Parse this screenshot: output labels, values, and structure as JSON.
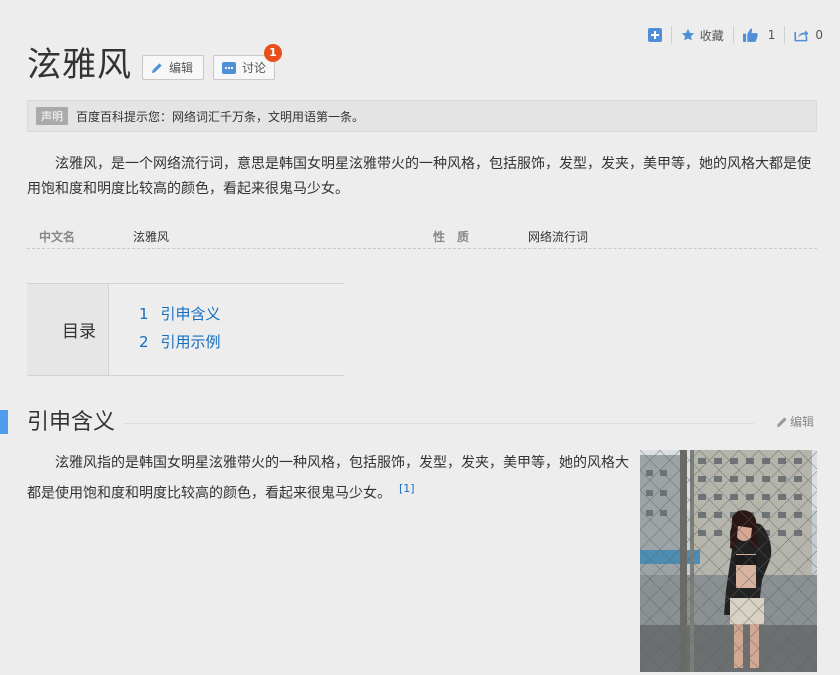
{
  "toolbar": {
    "add_icon": "plus-square-icon",
    "collect_label": "收藏",
    "like_count": "1",
    "share_count": "0"
  },
  "header": {
    "title": "泫雅风",
    "edit_label": "编辑",
    "discuss_label": "讨论",
    "discuss_badge": "1"
  },
  "notice": {
    "tag": "声明",
    "text": "百度百科提示您：网络词汇千万条，文明用语第一条。"
  },
  "summary": "泫雅风，是一个网络流行词，意思是韩国女明星泫雅带火的一种风格，包括服饰，发型，发夹，美甲等，她的风格大都是使用饱和度和明度比较高的颜色，看起来很鬼马少女。",
  "basic_info": [
    {
      "key": "中文名",
      "value": "泫雅风"
    },
    {
      "key": "性　质",
      "value": "网络流行词"
    }
  ],
  "toc": {
    "label": "目录",
    "items": [
      {
        "num": "1",
        "text": "引申含义"
      },
      {
        "num": "2",
        "text": "引用示例"
      }
    ]
  },
  "section1": {
    "title": "引申含义",
    "edit_label": "编辑",
    "text": "泫雅风指的是韩国女明星泫雅带火的一种风格，包括服饰，发型，发夹，美甲等，她的风格大都是使用饱和度和明度比较高的颜色，看起来很鬼马少女。",
    "ref": "[1]"
  },
  "colors": {
    "accent": "#4f9cee",
    "link": "#136ec2",
    "badge": "#e84f1c"
  }
}
